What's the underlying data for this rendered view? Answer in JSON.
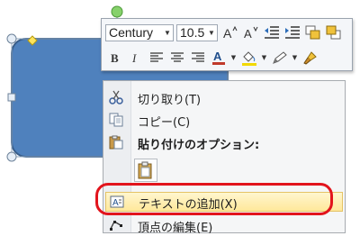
{
  "toolbar": {
    "font_name": "Century",
    "font_size": "10.5"
  },
  "context_menu": {
    "items": [
      {
        "label": "切り取り(T)",
        "icon": "scissors-icon"
      },
      {
        "label": "コピー(C)",
        "icon": "copy-icon"
      },
      {
        "label": "貼り付けのオプション:",
        "icon": "paste-icon"
      },
      {
        "label": "テキストの追加(X)",
        "icon": "text-box-icon"
      },
      {
        "label": "頂点の編集(E)",
        "icon": "edit-points-icon"
      }
    ]
  },
  "colors": {
    "shape_fill": "#4f81bd",
    "shape_border": "#385d8a",
    "highlight_ring": "#e2141c",
    "font_color_bar": "#c0392b",
    "fill_color_bar": "#f2d900"
  }
}
